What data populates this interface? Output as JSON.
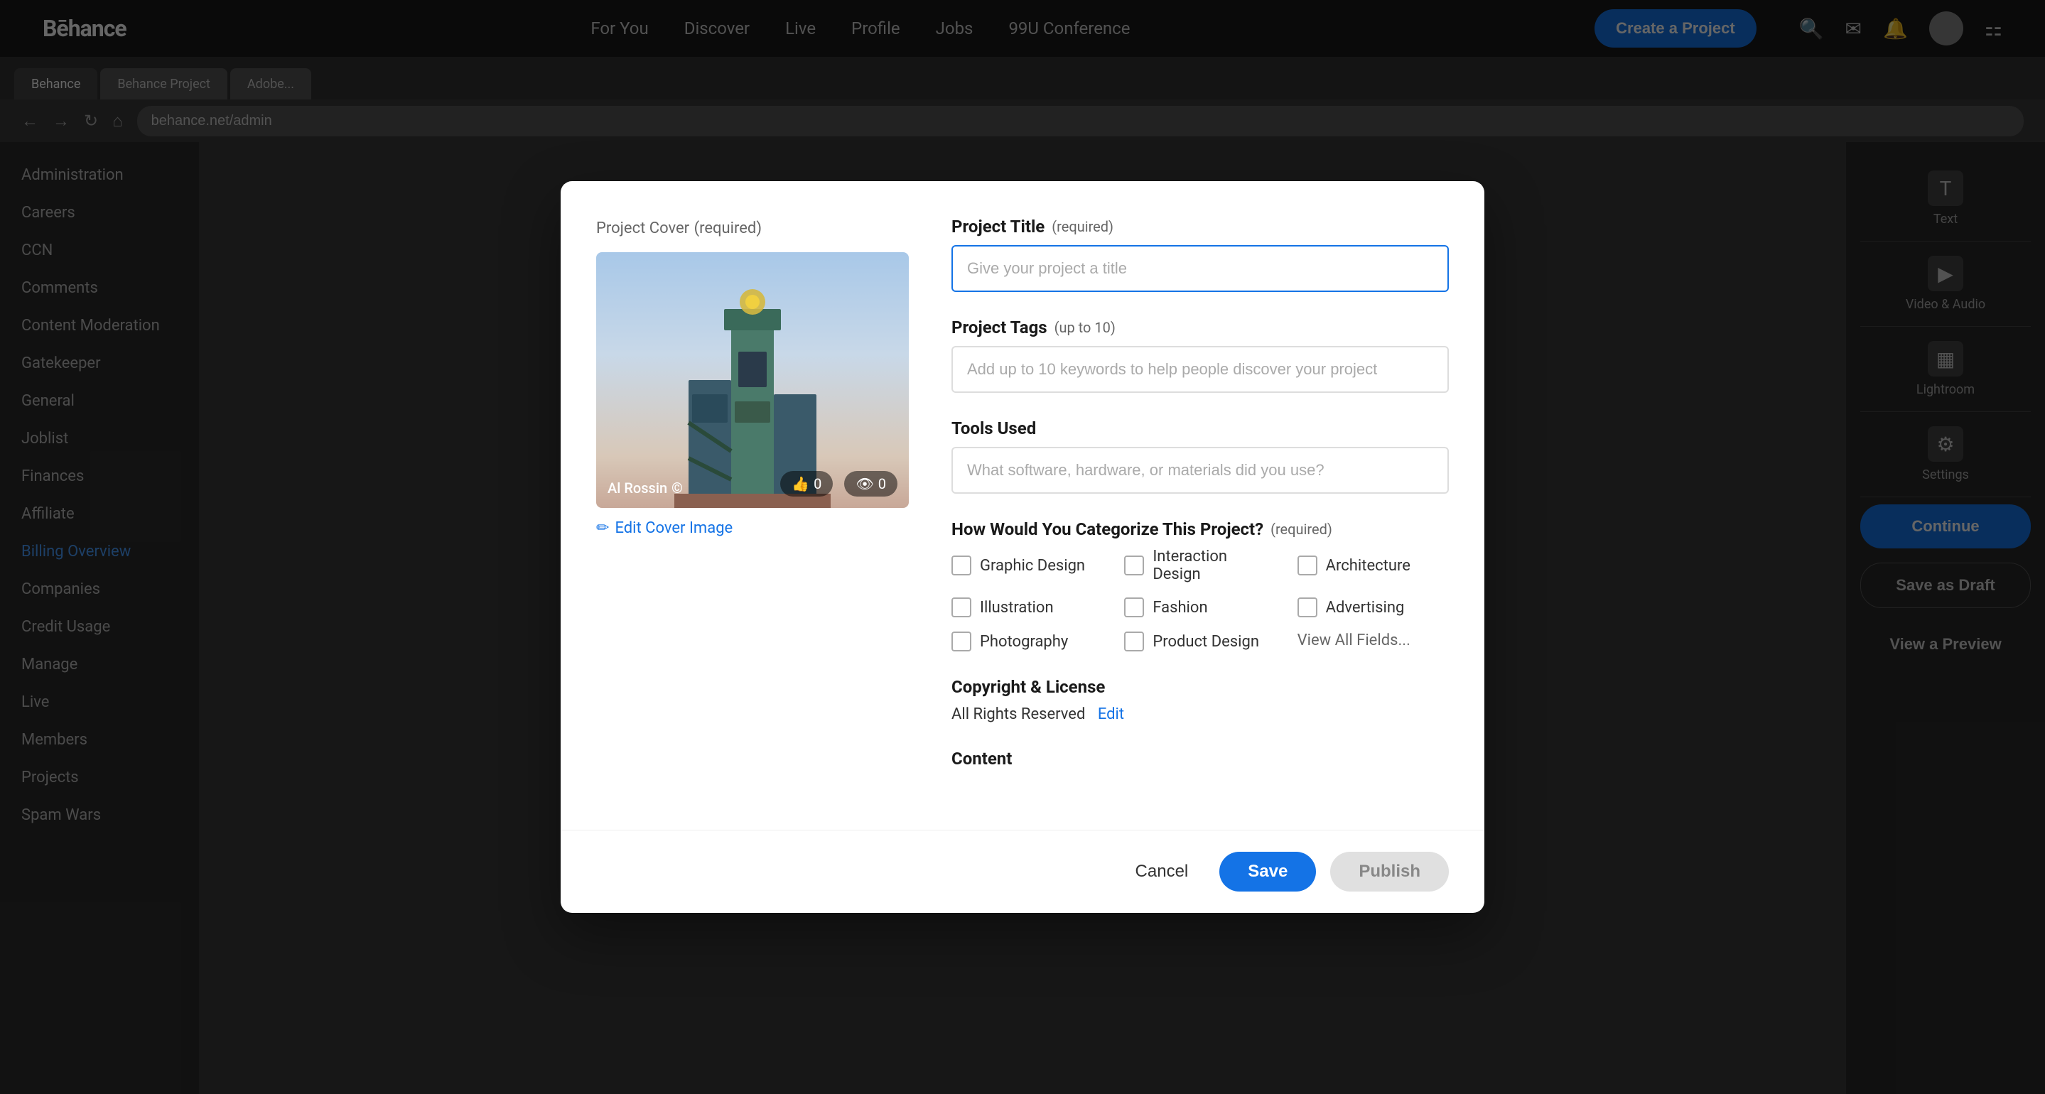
{
  "nav": {
    "logo": "Bēhance",
    "links": [
      "For You",
      "Discover",
      "Live",
      "Profile",
      "Jobs",
      "99U Conference"
    ],
    "create_button": "Create a Project"
  },
  "sidebar": {
    "items": [
      "Administration",
      "Careers",
      "CCN",
      "Comments",
      "Content Moderation",
      "Gatekeeper",
      "General",
      "Joblist",
      "Finances",
      "Affiliate",
      "Billing Overview",
      "Companies",
      "Credit Usage",
      "Manage",
      "Live",
      "Members",
      "Projects",
      "Spam Wars"
    ]
  },
  "right_panel": {
    "buttons": {
      "continue": "Continue",
      "save_draft": "Save as Draft",
      "preview": "View a Preview"
    }
  },
  "modal": {
    "cover": {
      "label": "Project Cover",
      "required": "(required)",
      "author": "Al Rossin",
      "likes": "0",
      "views": "0",
      "edit_link": "Edit Cover Image"
    },
    "form": {
      "title_label": "Project Title",
      "title_required": "(required)",
      "title_placeholder": "Give your project a title",
      "tags_label": "Project Tags",
      "tags_sub": "(up to 10)",
      "tags_placeholder": "Add up to 10 keywords to help people discover your project",
      "tools_label": "Tools Used",
      "tools_placeholder": "What software, hardware, or materials did you use?",
      "category_label": "How Would You Categorize This Project?",
      "category_required": "(required)",
      "categories": [
        {
          "col": 0,
          "name": "Graphic Design"
        },
        {
          "col": 1,
          "name": "Interaction Design"
        },
        {
          "col": 2,
          "name": "Architecture"
        },
        {
          "col": 0,
          "name": "Illustration"
        },
        {
          "col": 1,
          "name": "Fashion"
        },
        {
          "col": 2,
          "name": "Advertising"
        },
        {
          "col": 0,
          "name": "Photography"
        },
        {
          "col": 1,
          "name": "Product Design"
        }
      ],
      "view_all": "View All Fields...",
      "copyright_label": "Copyright & License",
      "copyright_value": "All Rights Reserved",
      "copyright_edit": "Edit",
      "content_label": "Content"
    },
    "footer": {
      "cancel": "Cancel",
      "save": "Save",
      "publish": "Publish"
    }
  }
}
